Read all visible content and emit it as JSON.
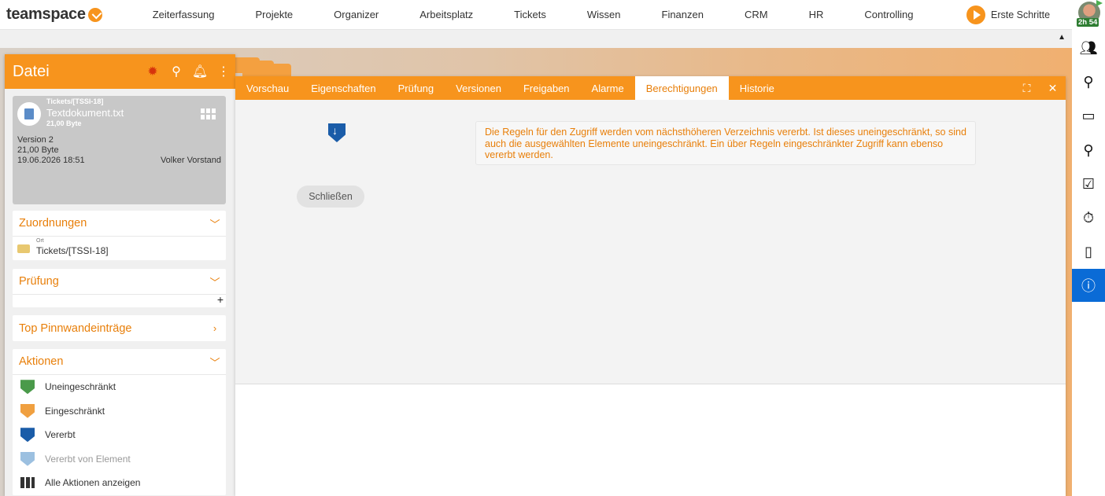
{
  "app": {
    "logo_text": "teamspace",
    "nav": [
      "Zeiterfassung",
      "Projekte",
      "Organizer",
      "Arbeitsplatz",
      "Tickets",
      "Wissen",
      "Finanzen",
      "CRM",
      "HR",
      "Controlling"
    ],
    "first_steps": "Erste Schritte",
    "timer": "2h 54",
    "accent": "#f7941d"
  },
  "sidebar_icons": [
    "contacts-icon",
    "search-icon",
    "briefcase-icon",
    "pin-icon",
    "task-check-icon",
    "stopwatch-icon",
    "mobile-icon",
    "info-icon"
  ],
  "left_panel": {
    "title": "Datei",
    "file": {
      "path": "Tickets/[TSSI-18]",
      "name": "Textdokument.txt",
      "size_small": "21,00 Byte",
      "version": "Version 2",
      "size": "21,00 Byte",
      "date": "19.06.2026 18:51",
      "user": "Volker Vorstand"
    },
    "zuordnungen": {
      "title": "Zuordnungen",
      "ort_label": "Ort",
      "ort_value": "Tickets/[TSSI-18]"
    },
    "pruefung": {
      "title": "Prüfung"
    },
    "pinnwand": {
      "title": "Top Pinnwandeinträge"
    },
    "aktionen": {
      "title": "Aktionen",
      "items": [
        "Uneingeschränkt",
        "Eingeschränkt",
        "Vererbt",
        "Vererbt von Element",
        "Alle Aktionen anzeigen"
      ]
    }
  },
  "dialog": {
    "tabs": [
      "Vorschau",
      "Eigenschaften",
      "Prüfung",
      "Versionen",
      "Freigaben",
      "Alarme",
      "Berechtigungen",
      "Historie"
    ],
    "active_tab": "Berechtigungen",
    "notice": "Die Regeln für den Zugriff werden vom nächsthöheren Verzeichnis vererbt. Ist dieses uneingeschränkt, so sind auch die ausgewählten Elemente uneingeschränkt. Ein über Regeln eingeschränkter Zugriff kann ebenso vererbt werden.",
    "close_button": "Schließen"
  }
}
